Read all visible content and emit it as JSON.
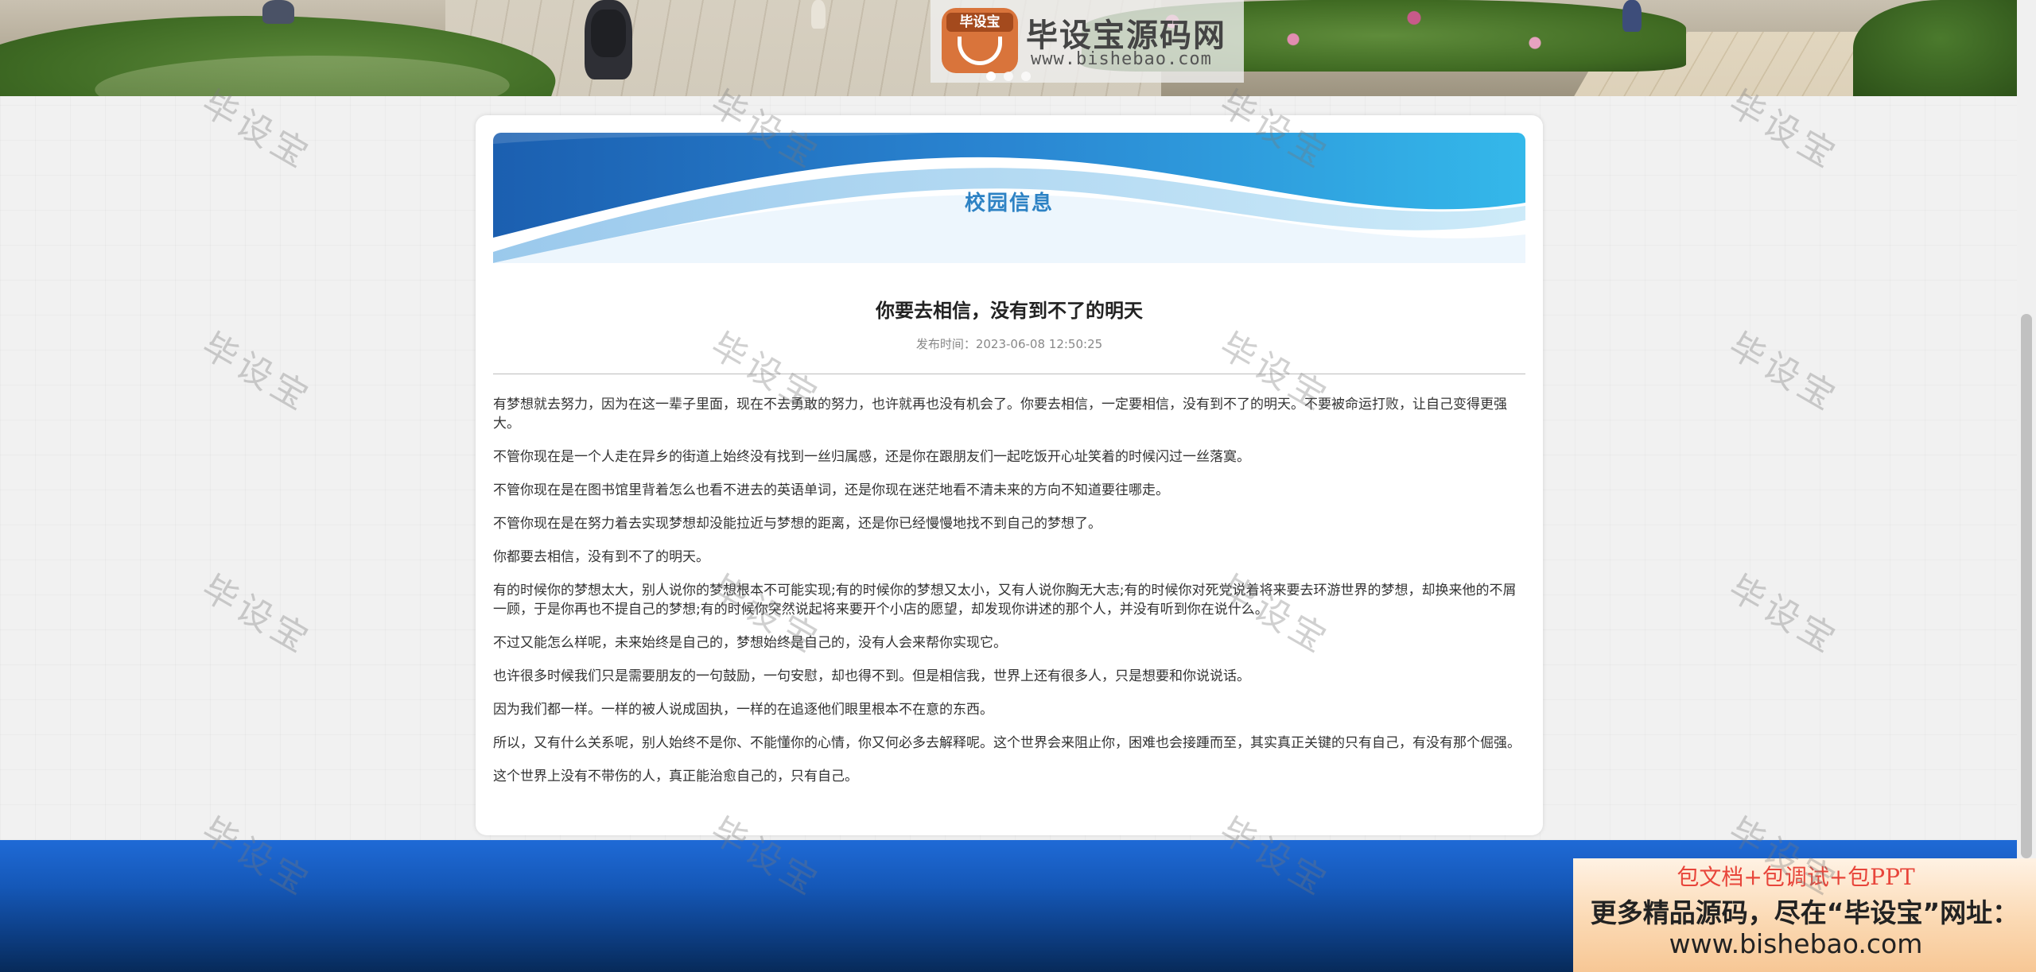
{
  "banner": {
    "logo_mark_text": "毕设宝",
    "logo_title": "毕设宝源码网",
    "logo_url": "www.bishebao.com"
  },
  "section": {
    "title": "校园信息"
  },
  "article": {
    "title": "你要去相信，没有到不了的明天",
    "meta": "发布时间：2023-06-08 12:50:25",
    "paragraphs": [
      "有梦想就去努力，因为在这一辈子里面，现在不去勇敢的努力，也许就再也没有机会了。你要去相信，一定要相信，没有到不了的明天。不要被命运打败，让自己变得更强大。",
      "不管你现在是一个人走在异乡的街道上始终没有找到一丝归属感，还是你在跟朋友们一起吃饭开心址笑着的时候闪过一丝落寞。",
      "不管你现在是在图书馆里背着怎么也看不进去的英语单词，还是你现在迷茫地看不清未来的方向不知道要往哪走。",
      "不管你现在是在努力着去实现梦想却没能拉近与梦想的距离，还是你已经慢慢地找不到自己的梦想了。",
      "你都要去相信，没有到不了的明天。",
      "有的时候你的梦想太大，别人说你的梦想根本不可能实现;有的时候你的梦想又太小，又有人说你胸无大志;有的时候你对死党说着将来要去环游世界的梦想，却换来他的不屑一顾，于是你再也不提自己的梦想;有的时候你突然说起将来要开个小店的愿望，却发现你讲述的那个人，并没有听到你在说什么。",
      "不过又能怎么样呢，未来始终是自己的，梦想始终是自己的，没有人会来帮你实现它。",
      "也许很多时候我们只是需要朋友的一句鼓励，一句安慰，却也得不到。但是相信我，世界上还有很多人，只是想要和你说说话。",
      "因为我们都一样。一样的被人说成固执，一样的在追逐他们眼里根本不在意的东西。",
      "所以，又有什么关系呢，别人始终不是你、不能懂你的心情，你又何必多去解释呢。这个世界会来阻止你，困难也会接踵而至，其实真正关键的只有自己，有没有那个倔强。",
      "这个世界上没有不带伤的人，真正能治愈自己的，只有自己。"
    ]
  },
  "promo": {
    "line1": "包文档+包调试+包PPT",
    "line2": "更多精品源码，尽在“毕设宝”网址：",
    "line3": "www.bishebao.com"
  },
  "watermark": {
    "text": "毕设宝"
  },
  "colors": {
    "section_title": "#2d82c4",
    "footer": "#1558b8",
    "promo_red": "#e8453a"
  }
}
